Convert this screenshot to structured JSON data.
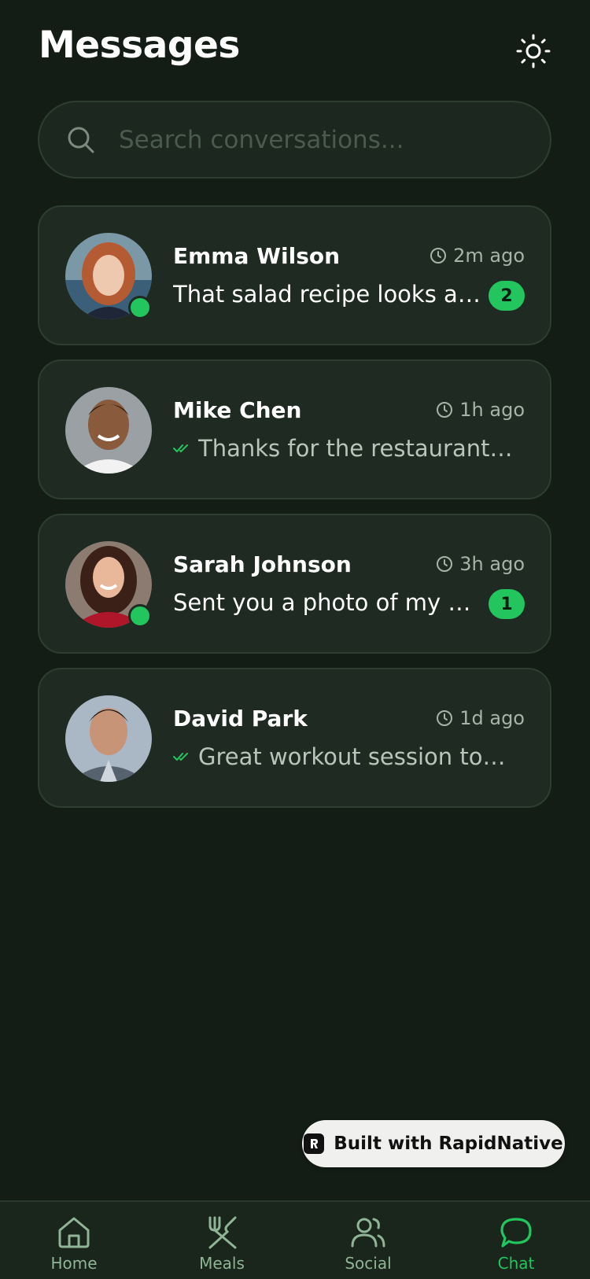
{
  "header": {
    "title": "Messages"
  },
  "search": {
    "placeholder": "Search conversations..."
  },
  "conversations": [
    {
      "name": "Emma Wilson",
      "time": "2m ago",
      "preview": "That salad recipe looks amazing!",
      "unread": "2",
      "online": true,
      "read": false
    },
    {
      "name": "Mike Chen",
      "time": "1h ago",
      "preview": "Thanks for the restaurant recommendation",
      "unread": null,
      "online": false,
      "read": true
    },
    {
      "name": "Sarah Johnson",
      "time": "3h ago",
      "preview": "Sent you a photo of my meal prep",
      "unread": "1",
      "online": true,
      "read": false
    },
    {
      "name": "David Park",
      "time": "1d ago",
      "preview": "Great workout session today!",
      "unread": null,
      "online": false,
      "read": true
    }
  ],
  "banner": {
    "label": "Built with RapidNative"
  },
  "tabs": [
    {
      "label": "Home",
      "icon": "home-icon",
      "active": false
    },
    {
      "label": "Meals",
      "icon": "utensils-icon",
      "active": false
    },
    {
      "label": "Social",
      "icon": "users-icon",
      "active": false
    },
    {
      "label": "Chat",
      "icon": "chat-bubble-icon",
      "active": true
    }
  ],
  "colors": {
    "accent": "#22c55e",
    "background": "#131d16",
    "card": "#1f2b22",
    "inactive_tab": "#8fb596"
  }
}
